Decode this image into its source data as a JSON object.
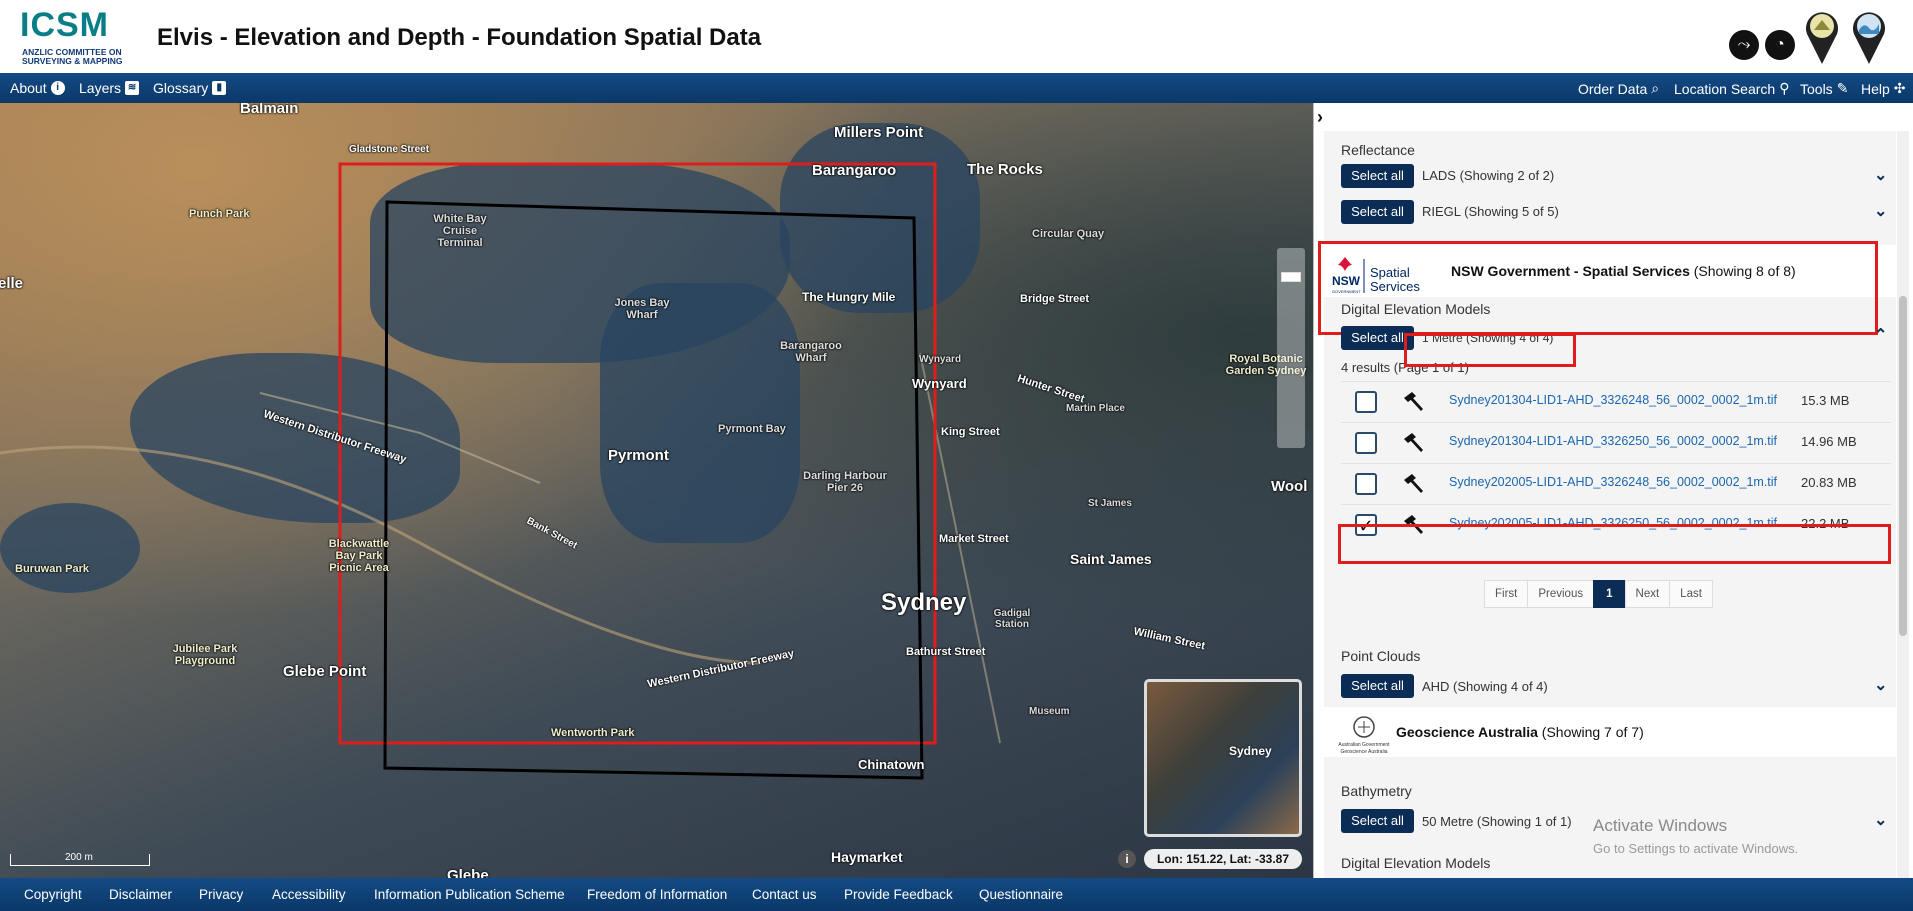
{
  "header": {
    "logo_word": "ICSM",
    "logo_subtitle": "ANZLIC COMMITTEE ON SURVEYING & MAPPING",
    "title": "Elvis - Elevation and Depth - Foundation Spatial Data",
    "icons": [
      "share-icon",
      "aperture-icon",
      "elevation-pin-icon",
      "bathymetry-pin-icon"
    ]
  },
  "nav": {
    "left": [
      {
        "label": "About",
        "icon": "info-icon"
      },
      {
        "label": "Layers",
        "icon": "layers-icon"
      },
      {
        "label": "Glossary",
        "icon": "book-icon"
      }
    ],
    "right": [
      {
        "label": "Order Data",
        "icon": "search-icon"
      },
      {
        "label": "Location Search",
        "icon": "map-pin-icon"
      },
      {
        "label": "Tools",
        "icon": "pencil-icon"
      },
      {
        "label": "Help",
        "icon": "help-icon"
      }
    ]
  },
  "map": {
    "labels": {
      "balmain": "Balmain",
      "millers_point": "Millers Point",
      "barangaroo": "Barangaroo",
      "the_rocks": "The Rocks",
      "gladstone": "Gladstone Street",
      "punch_park": "Punch Park",
      "white_bay": "White Bay Cruise Terminal",
      "circular_quay": "Circular Quay",
      "jones_bay": "Jones Bay Wharf",
      "hungry_mile": "The Hungry Mile",
      "bridge_st": "Bridge Street",
      "barangaroo_wharf": "Barangaroo Wharf",
      "wynyard_small": "Wynyard",
      "wynyard": "Wynyard",
      "hunter_st": "Hunter Street",
      "royal_botanic": "Royal Botanic Garden Sydney",
      "pyrmont_bay": "Pyrmont Bay",
      "martin_place": "Martin Place",
      "king_st": "King Street",
      "pyrmont": "Pyrmont",
      "western_freeway": "Western Distributor Freeway",
      "bank_st": "Bank Street",
      "darling_harbour": "Darling Harbour Pier 26",
      "market_st": "Market Street",
      "st_james_small": "St James",
      "saint_james": "Saint James",
      "blackwattle": "Blackwattle Bay Park Picnic Area",
      "buruwan": "Buruwan Park",
      "sydney": "Sydney",
      "gadigal": "Gadigal Station",
      "bathurst_st": "Bathurst Street",
      "william_st": "William Street",
      "jubilee": "Jubilee Park Playground",
      "glebe_point": "Glebe Point",
      "western_freeway2": "Western Distributor Freeway",
      "wentworth_park": "Wentworth Park",
      "chinatown": "Chinatown",
      "museum": "Museum",
      "haymarket": "Haymarket",
      "glebe": "Glebe",
      "elle": "elle",
      "wool": "Wool"
    },
    "scale_label": "200 m",
    "minimap_label": "Sydney",
    "coordinates": "Lon: 151.22, Lat: -33.87"
  },
  "panel": {
    "reflectance": {
      "title": "Reflectance",
      "rows": [
        {
          "button": "Select all",
          "label": "LADS (Showing 2 of 2)"
        },
        {
          "button": "Select all",
          "label": "RIEGL (Showing 5 of 5)"
        }
      ]
    },
    "nsw": {
      "name": "NSW Government - Spatial Services",
      "count": "(Showing 8 of 8)",
      "logo_nsw": "NSW",
      "logo_text1": "Spatial",
      "logo_text2": "Services",
      "logo_gov": "GOVERNMENT",
      "dem_title": "Digital Elevation Models",
      "dem_button": "Select all",
      "dem_label": "1 Metre (Showing 4 of 4)",
      "results_summary": "4 results (Page 1 of 1)",
      "results": [
        {
          "file": "Sydney201304-LID1-AHD_3326248_56_0002_0002_1m.tif",
          "size": "15.3 MB",
          "checked": false
        },
        {
          "file": "Sydney201304-LID1-AHD_3326250_56_0002_0002_1m.tif",
          "size": "14.96 MB",
          "checked": false
        },
        {
          "file": "Sydney202005-LID1-AHD_3326248_56_0002_0002_1m.tif",
          "size": "20.83 MB",
          "checked": false
        },
        {
          "file": "Sydney202005-LID1-AHD_3326250_56_0002_0002_1m.tif",
          "size": "22.2 MB",
          "checked": true
        }
      ],
      "pager": {
        "first": "First",
        "previous": "Previous",
        "current": "1",
        "next": "Next",
        "last": "Last"
      },
      "pc_title": "Point Clouds",
      "pc_button": "Select all",
      "pc_label": "AHD (Showing 4 of 4)"
    },
    "ga": {
      "name": "Geoscience Australia",
      "count": "(Showing 7 of 7)",
      "logo_text": "Australian Government Geoscience Australia",
      "bathy_title": "Bathymetry",
      "bathy_button": "Select all",
      "bathy_label": "50 Metre (Showing 1 of 1)",
      "dem_title": "Digital Elevation Models"
    }
  },
  "watermark": {
    "line1": "Activate Windows",
    "line2": "Go to Settings to activate Windows."
  },
  "footer": [
    "Copyright",
    "Disclaimer",
    "Privacy",
    "Accessibility",
    "Information Publication Scheme",
    "Freedom of Information",
    "Contact us",
    "Provide Feedback",
    "Questionnaire"
  ],
  "colors": {
    "nav_bar": "#0b3868",
    "select_button": "#0b2d55",
    "highlight": "#e01d1d",
    "link": "#1b66b0",
    "brand_teal": "#0a7e86"
  }
}
